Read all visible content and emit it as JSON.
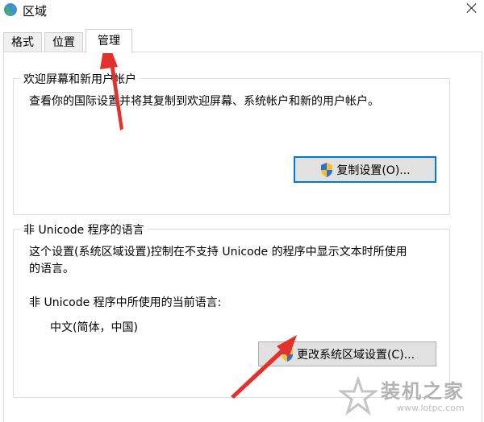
{
  "window": {
    "title": "区域"
  },
  "tabs": [
    {
      "label": "格式"
    },
    {
      "label": "位置"
    },
    {
      "label": "管理"
    }
  ],
  "welcome_group": {
    "title": "欢迎屏幕和新用户帐户",
    "description": "查看你的国际设置并将其复制到欢迎屏幕、系统帐户和新的用户帐户。",
    "copy_button": "复制设置(O)..."
  },
  "unicode_group": {
    "title": "非 Unicode 程序的语言",
    "description_line1": "这个设置(系统区域设置)控制在不支持 Unicode 的程序中显示文本时所使用",
    "description_line2": "的语言。",
    "current_label": "非 Unicode 程序中所使用的当前语言:",
    "current_value": "中文(简体，中国)",
    "change_button": "更改系统区域设置(C)..."
  },
  "watermark": {
    "brand": "装机之家",
    "url": "www.lotpc.com"
  },
  "colors": {
    "arrow": "#e3322b",
    "accent": "#0078d7"
  }
}
